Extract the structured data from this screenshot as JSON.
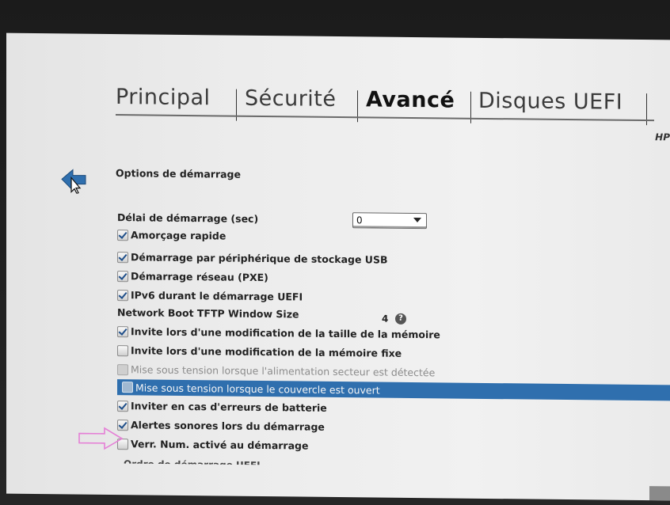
{
  "tabs": [
    {
      "label": "Principal"
    },
    {
      "label": "Sécurité"
    },
    {
      "label": "Avancé"
    },
    {
      "label": "Disques UEFI"
    }
  ],
  "vendor": "HP",
  "section_title": "Options de démarrage",
  "boot_delay": {
    "label": "Délai de démarrage (sec)",
    "value": "0"
  },
  "options": [
    {
      "label": "Amorçage rapide",
      "checked": true
    },
    {
      "label": "Démarrage par périphérique de stockage USB",
      "checked": true
    },
    {
      "label": "Démarrage réseau (PXE)",
      "checked": true
    },
    {
      "label": "IPv6 durant le démarrage UEFI",
      "checked": true
    }
  ],
  "tftp": {
    "label": "Network Boot TFTP Window Size",
    "value": "4",
    "help": "?"
  },
  "options2": [
    {
      "label": "Invite lors d'une modification de la taille de la mémoire",
      "checked": true
    },
    {
      "label": "Invite lors d'une modification de la mémoire fixe",
      "checked": false
    },
    {
      "label": "Mise sous tension lorsque l'alimentation secteur est détectée",
      "checked": false,
      "disabled": true
    },
    {
      "label": "Mise sous tension lorsque le couvercle est ouvert",
      "checked": false,
      "highlighted": true
    },
    {
      "label": "Inviter en cas d'erreurs de batterie",
      "checked": true
    },
    {
      "label": "Alertes sonores lors du démarrage",
      "checked": true
    },
    {
      "label": "Verr. Num. activé au démarrage",
      "checked": false
    }
  ],
  "cut_row": "Ordre de démarrage UEFI",
  "colors": {
    "highlight": "#2f6fae",
    "annotation_arrow": "#e57fd6",
    "back_arrow": "#2f6fae"
  }
}
